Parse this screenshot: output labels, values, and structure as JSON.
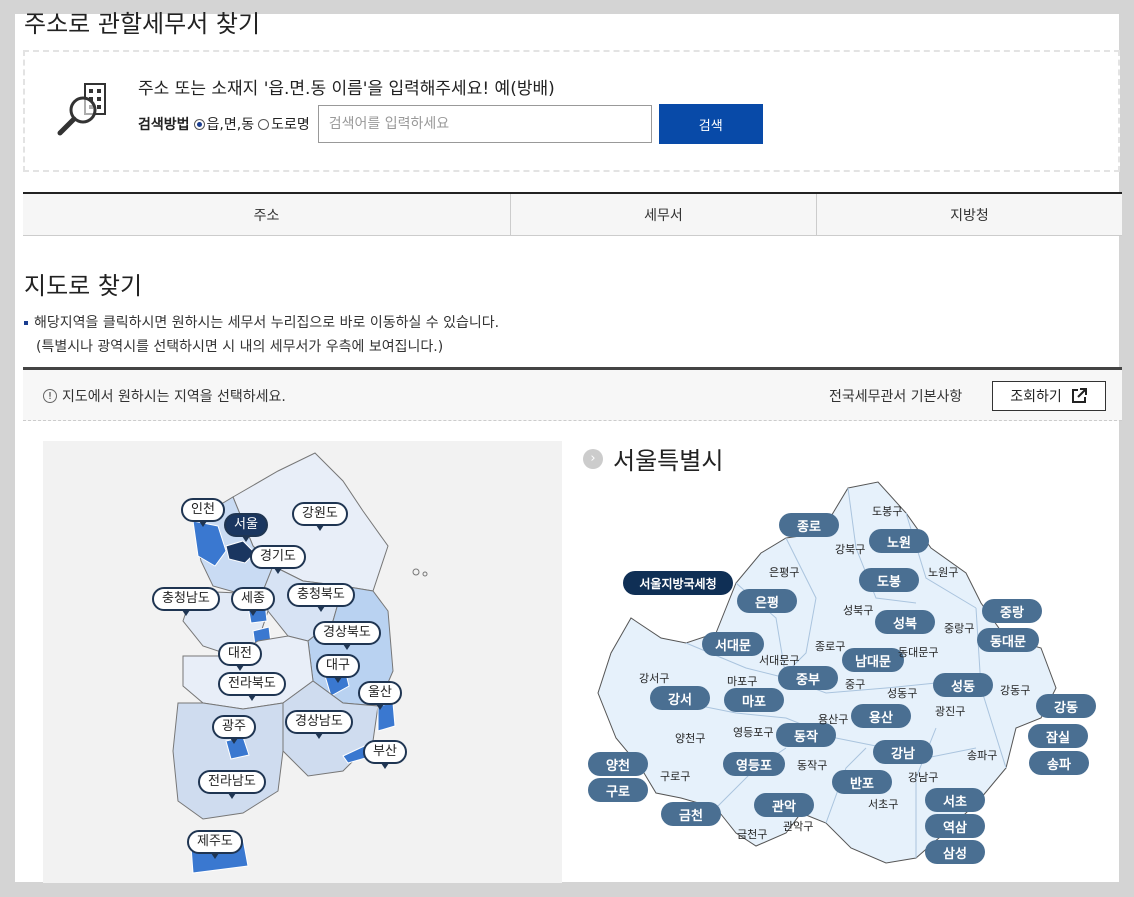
{
  "page_title": "주소로 관할세무서 찾기",
  "search": {
    "description": "주소 또는 소재지 '읍.면.동 이름'을 입력해주세요! 예(방배)",
    "method_label": "검색방법",
    "options": [
      "읍,면,동",
      "도로명"
    ],
    "selected_option": "읍,면,동",
    "placeholder": "검색어를 입력하세요",
    "value": "",
    "button_label": "검색"
  },
  "tabs": [
    "주소",
    "세무서",
    "지방청"
  ],
  "map_section": {
    "title": "지도로 찾기",
    "note1": "해당지역을 클릭하시면 원하시는 세무서 누리집으로 바로 이동하실 수 있습니다.",
    "note2": "(특별시나 광역시를 선택하시면 시 내의 세무서가 우측에 보여집니다.)",
    "info_text": "지도에서 원하시는 지역을 선택하세요.",
    "info_icon": "!",
    "basic_label": "전국세무관서 기본사항",
    "query_button": "조회하기"
  },
  "korea_map": {
    "selected": "서울",
    "regions": [
      "인천",
      "서울",
      "강원도",
      "경기도",
      "충청남도",
      "세종",
      "충청북도",
      "경상북도",
      "대전",
      "대구",
      "전라북도",
      "울산",
      "광주",
      "경상남도",
      "부산",
      "전라남도",
      "제주도"
    ]
  },
  "seoul_map": {
    "title": "서울특별시",
    "regional_office": "서울지방국세청",
    "tax_offices": [
      "종로",
      "노원",
      "도봉",
      "은평",
      "중랑",
      "성북",
      "서대문",
      "동대문",
      "남대문",
      "중부",
      "마포",
      "성동",
      "강서",
      "강동",
      "용산",
      "동작",
      "잠실",
      "강남",
      "양천",
      "영등포",
      "송파",
      "구로",
      "반포",
      "관악",
      "서초",
      "금천",
      "역삼",
      "삼성"
    ],
    "districts": [
      "도봉구",
      "강북구",
      "노원구",
      "은평구",
      "성북구",
      "중랑구",
      "종로구",
      "서대문구",
      "동대문구",
      "중구",
      "강서구",
      "마포구",
      "성동구",
      "광진구",
      "강동구",
      "용산구",
      "양천구",
      "영등포구",
      "동작구",
      "송파구",
      "구로구",
      "강남구",
      "서초구",
      "금천구",
      "관악구"
    ]
  },
  "colors": {
    "accent": "#084aa8",
    "pill": "#4a6f92",
    "pill_dark": "#0f2f55",
    "map_dark": "#3a78d0",
    "map_light": "#b9d2f1"
  }
}
